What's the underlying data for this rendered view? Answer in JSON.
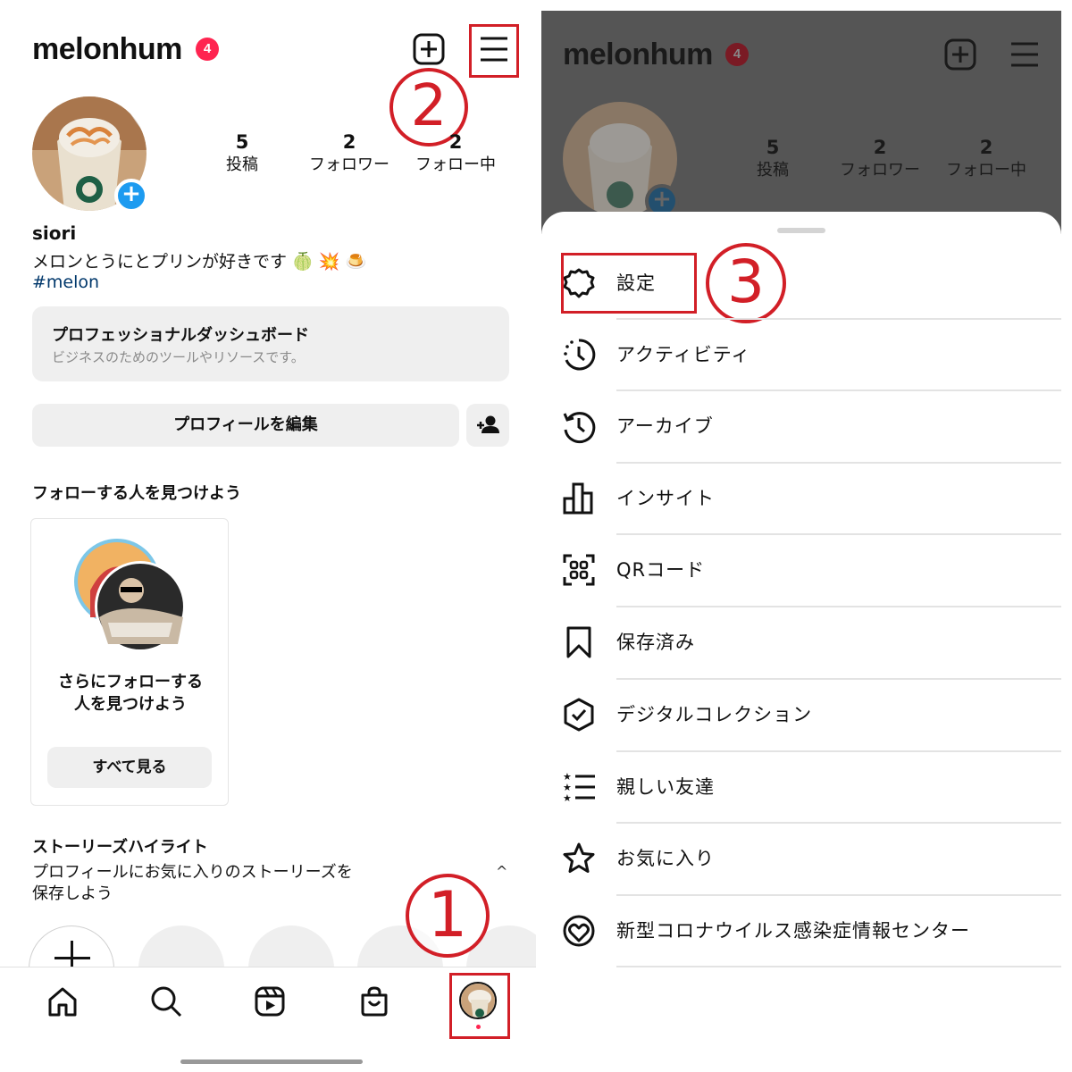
{
  "left": {
    "username": "melonhum",
    "notification_badge": "4",
    "stats": [
      {
        "num": "5",
        "label": "投稿"
      },
      {
        "num": "2",
        "label": "フォロワー"
      },
      {
        "num": "2",
        "label": "フォロー中"
      }
    ],
    "name": "siori",
    "bio": "メロンとうにとプリンが好きです",
    "bio_emoji": [
      "🍈",
      "💥",
      "🍮"
    ],
    "hashtag": "#melon",
    "dashboard": {
      "title": "プロフェッショナルダッシュボード",
      "subtitle": "ビジネスのためのツールやリソースです。"
    },
    "edit_profile_label": "プロフィールを編集",
    "discover": {
      "heading": "フォローする人を見つけよう",
      "card_text_line1": "さらにフォローする",
      "card_text_line2": "人を見つけよう",
      "see_all_label": "すべて見る"
    },
    "highlights": {
      "title": "ストーリーズハイライト",
      "desc_line1": "プロフィールにお気に入りのストーリーズを",
      "desc_line2": "保存しよう",
      "chevron": "^"
    },
    "annotations": {
      "step1": "1",
      "step2": "2"
    }
  },
  "right": {
    "username": "melonhum",
    "notification_badge": "4",
    "stats": [
      {
        "num": "5",
        "label": "投稿"
      },
      {
        "num": "2",
        "label": "フォロワー"
      },
      {
        "num": "2",
        "label": "フォロー中"
      }
    ],
    "menu": [
      {
        "label": "設定",
        "icon": "gear-icon"
      },
      {
        "label": "アクティビティ",
        "icon": "activity-icon"
      },
      {
        "label": "アーカイブ",
        "icon": "archive-icon"
      },
      {
        "label": "インサイト",
        "icon": "insights-icon"
      },
      {
        "label": "QRコード",
        "icon": "qr-code-icon"
      },
      {
        "label": "保存済み",
        "icon": "bookmark-icon"
      },
      {
        "label": "デジタルコレクション",
        "icon": "digital-collection-icon"
      },
      {
        "label": "親しい友達",
        "icon": "close-friends-icon"
      },
      {
        "label": "お気に入り",
        "icon": "star-icon"
      },
      {
        "label": "新型コロナウイルス感染症情報センター",
        "icon": "covid-info-icon"
      }
    ],
    "annotations": {
      "step3": "3"
    }
  },
  "colors": {
    "annotation_red": "#d21f27",
    "badge_red": "#ff2450",
    "hashtag_blue": "#00376b",
    "add_blue": "#1d9bf0",
    "dim_overlay": "#555555"
  }
}
